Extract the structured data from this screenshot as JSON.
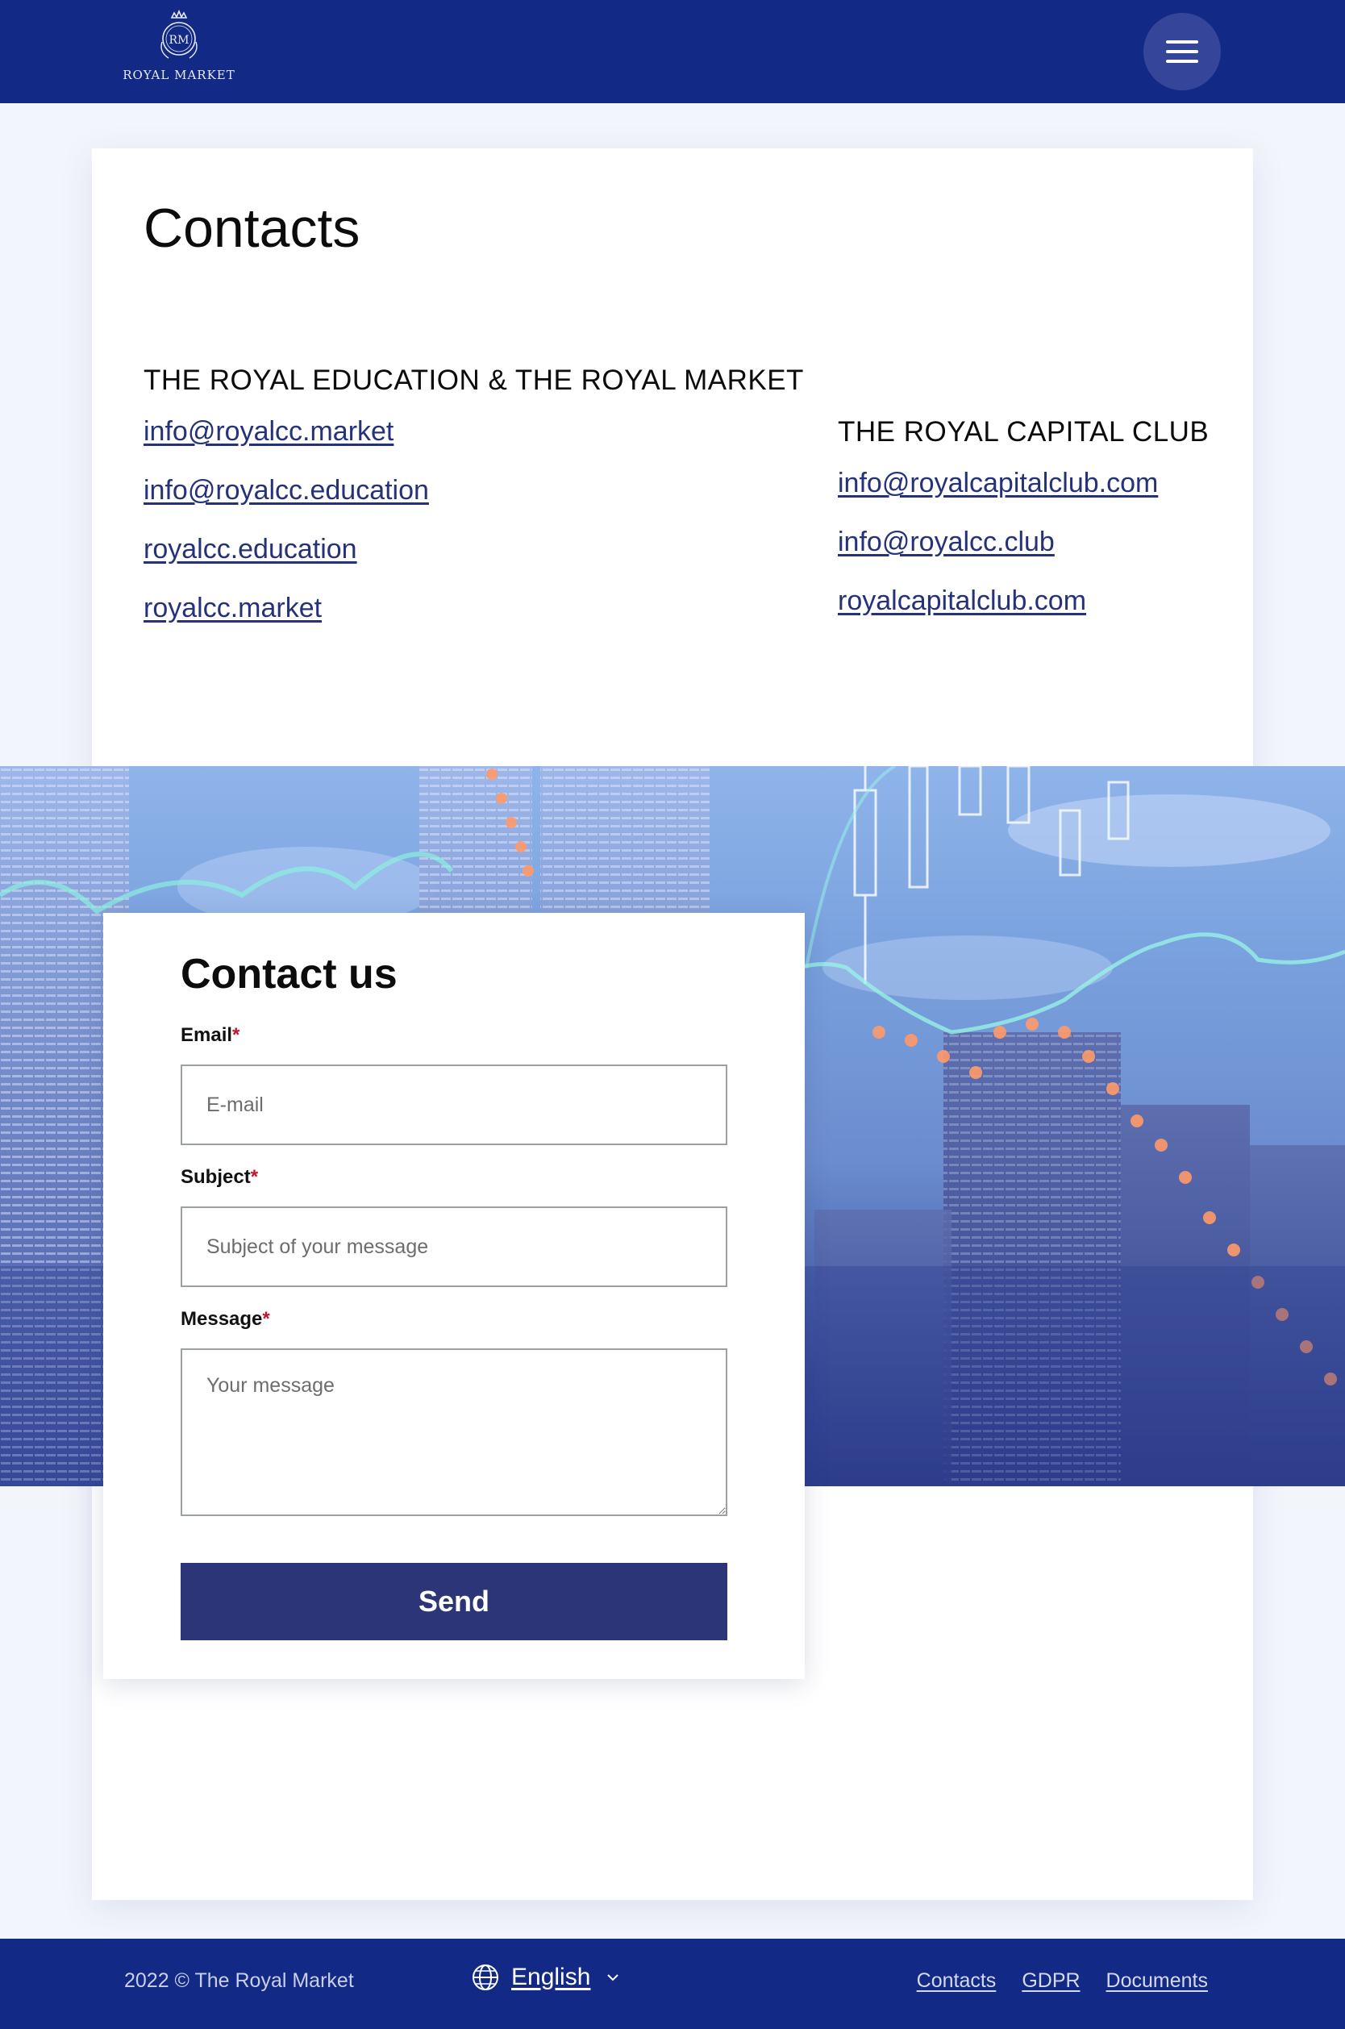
{
  "header": {
    "logo_monogram": "RM",
    "logo_text": "ROYAL MARKET",
    "menu_icon": "hamburger-menu-icon"
  },
  "contacts": {
    "title": "Contacts",
    "left": {
      "heading": "THE ROYAL EDUCATION & THE ROYAL MARKET",
      "links": [
        "info@royalcc.market",
        "info@royalcc.education",
        "royalcc.education",
        "royalcc.market"
      ]
    },
    "right": {
      "heading": "THE ROYAL CAPITAL CLUB",
      "links": [
        "info@royalcapitalclub.com",
        "info@royalcc.club",
        "royalcapitalclub.com"
      ]
    }
  },
  "form": {
    "title": "Contact us",
    "required_mark": "*",
    "email": {
      "label": "Email",
      "placeholder": "E-mail"
    },
    "subject": {
      "label": "Subject",
      "placeholder": "Subject of your message"
    },
    "message": {
      "label": "Message",
      "placeholder": "Your message"
    },
    "submit_label": "Send"
  },
  "footer": {
    "copyright": "2022 © The Royal Market",
    "language": "English",
    "language_icon": "globe-icon",
    "links": [
      "Contacts",
      "GDPR",
      "Documents"
    ]
  },
  "colors": {
    "brand_navy": "#122985",
    "button_navy": "#2b3578",
    "link": "#25327a",
    "required": "#c8102e",
    "page_bg": "#f3f5fc"
  }
}
